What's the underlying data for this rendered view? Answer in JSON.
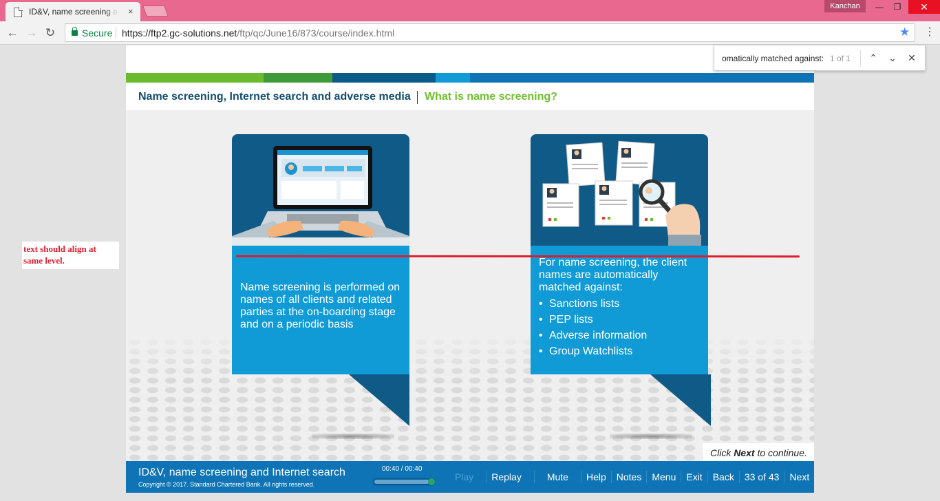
{
  "browser": {
    "tab_title": "ID&V, name screening and Internet search",
    "tab_close": "×",
    "user": "Kanchan",
    "win_min": "—",
    "win_restore": "❐",
    "win_close": "✕",
    "nav_back": "←",
    "nav_forward": "→",
    "nav_reload": "↻",
    "secure_label": "Secure",
    "url_host": "https://ftp2.gc-solutions.net",
    "url_path": "/ftp/qc/June16/873/course/index.html",
    "bookmark_glyph": "★",
    "menu_glyph": "⋮"
  },
  "findbar": {
    "query": "omatically matched against:",
    "count": "1 of 1",
    "prev": "⌃",
    "next": "⌄",
    "close": "✕"
  },
  "course": {
    "title": "Name screening, Internet search and adverse media",
    "section": "What is name screening?",
    "strip_colors": [
      "#6cbb2f",
      "#3f9a3a",
      "#0a5b89",
      "#109bd7",
      "#0e74b5"
    ],
    "left_card": {
      "text": "Name screening is performed on names of all clients and related parties at the on-boarding stage and on a periodic basis"
    },
    "right_card": {
      "intro": "For name screening, the client names are automatically matched against:",
      "bullets": [
        "Sanctions lists",
        "PEP lists",
        "Adverse information",
        "Group Watchlists"
      ]
    },
    "click_next": {
      "prefix": "Click ",
      "strong": "Next",
      "suffix": " to continue."
    },
    "footer": {
      "title": "ID&V, name screening and Internet search",
      "copyright": "Copyright © 2017. Standard Chartered Bank. All rights reserved.",
      "time": "00:40 / 00:40",
      "progress": 1.0,
      "links": {
        "play": "Play",
        "replay": "Replay",
        "mute": "Mute",
        "help": "Help",
        "notes": "Notes",
        "menu": "Menu",
        "exit": "Exit",
        "back": "Back",
        "page": "33 of 43",
        "next": "Next"
      }
    }
  },
  "annotation": {
    "note": "text should align at same level.",
    "color": "#e11c2a"
  },
  "colors": {
    "titlebar": "#e8688f",
    "card_dark": "#0f5a86",
    "card_light": "#109bd7",
    "footer": "#0e74b5",
    "heading": "#124d6e",
    "section": "#6fbf2f"
  }
}
